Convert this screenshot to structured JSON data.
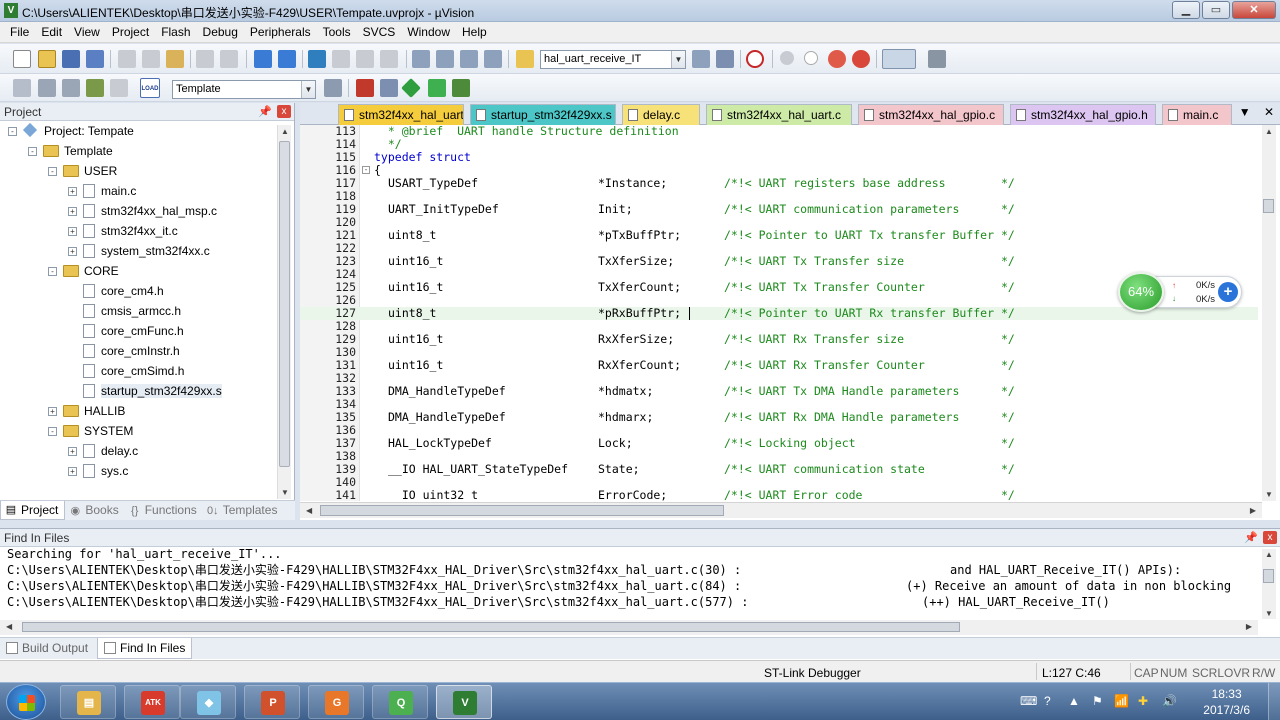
{
  "window": {
    "title": "C:\\Users\\ALIENTEK\\Desktop\\串口发送小实验-F429\\USER\\Tempate.uvprojx - µVision",
    "app_icon": "V",
    "controls": [
      "▁",
      "▭",
      "✕"
    ]
  },
  "menu": [
    "File",
    "Edit",
    "View",
    "Project",
    "Flash",
    "Debug",
    "Peripherals",
    "Tools",
    "SVCS",
    "Window",
    "Help"
  ],
  "toolbar": {
    "search_value": "hal_uart_receive_IT",
    "target_value": "Template",
    "load_label": "LOAD"
  },
  "project_panel": {
    "title": "Project",
    "pin": "📌",
    "close": "x",
    "tree": [
      {
        "label": "Project: Tempate",
        "kind": "project",
        "expander": "-"
      },
      {
        "label": "Template",
        "kind": "folder",
        "expander": "-"
      },
      {
        "label": "USER",
        "kind": "folder",
        "expander": "-"
      },
      {
        "label": "main.c",
        "kind": "file",
        "expander": "+"
      },
      {
        "label": "stm32f4xx_hal_msp.c",
        "kind": "file",
        "expander": "+"
      },
      {
        "label": "stm32f4xx_it.c",
        "kind": "file",
        "expander": "+"
      },
      {
        "label": "system_stm32f4xx.c",
        "kind": "file",
        "expander": "+"
      },
      {
        "label": "CORE",
        "kind": "folder",
        "expander": "-"
      },
      {
        "label": "core_cm4.h",
        "kind": "file",
        "expander": ""
      },
      {
        "label": "cmsis_armcc.h",
        "kind": "file",
        "expander": ""
      },
      {
        "label": "core_cmFunc.h",
        "kind": "file",
        "expander": ""
      },
      {
        "label": "core_cmInstr.h",
        "kind": "file",
        "expander": ""
      },
      {
        "label": "core_cmSimd.h",
        "kind": "file",
        "expander": ""
      },
      {
        "label": "startup_stm32f429xx.s",
        "kind": "file",
        "expander": ""
      },
      {
        "label": "HALLIB",
        "kind": "folder",
        "expander": "+"
      },
      {
        "label": "SYSTEM",
        "kind": "folder",
        "expander": "-"
      },
      {
        "label": "delay.c",
        "kind": "file",
        "expander": "+"
      },
      {
        "label": "sys.c",
        "kind": "file",
        "expander": "+"
      }
    ],
    "tabs": [
      {
        "label": "Project",
        "icon": "▤"
      },
      {
        "label": "Books",
        "icon": "◉"
      },
      {
        "label": "Functions",
        "icon": "{}"
      },
      {
        "label": "Templates",
        "icon": "0↓"
      }
    ]
  },
  "editor": {
    "tabs": [
      {
        "label": "stm32f4xx_hal_uart.h",
        "color": "#f5cd3c"
      },
      {
        "label": "startup_stm32f429xx.s",
        "color": "#4cc6c6"
      },
      {
        "label": "delay.c",
        "color": "#f7e27a"
      },
      {
        "label": "stm32f4xx_hal_uart.c",
        "color": "#cdeaa6"
      },
      {
        "label": "stm32f4xx_hal_gpio.c",
        "color": "#f3c6cc"
      },
      {
        "label": "stm32f4xx_hal_gpio.h",
        "color": "#dcc5f0"
      },
      {
        "label": "main.c",
        "color": "#f3c6cc"
      }
    ],
    "tab_controls": [
      "▼",
      "✕"
    ],
    "lines": [
      {
        "n": "113",
        "fold": "",
        "text": "  * @brief  UART handle Structure definition",
        "cls": "cm"
      },
      {
        "n": "114",
        "fold": "",
        "text": "  */",
        "cls": "cm"
      },
      {
        "n": "115",
        "fold": "",
        "kw": "typedef struct",
        "text": ""
      },
      {
        "n": "116",
        "fold": "-",
        "text": "{"
      },
      {
        "n": "117",
        "fold": "",
        "type": "USART_TypeDef",
        "field": "*Instance;",
        "comment": "/*!< UART registers base address        */"
      },
      {
        "n": "118",
        "fold": "",
        "text": ""
      },
      {
        "n": "119",
        "fold": "",
        "type": "UART_InitTypeDef",
        "field": "Init;",
        "comment": "/*!< UART communication parameters      */"
      },
      {
        "n": "120",
        "fold": "",
        "text": ""
      },
      {
        "n": "121",
        "fold": "",
        "type": "uint8_t",
        "field": "*pTxBuffPtr;",
        "comment": "/*!< Pointer to UART Tx transfer Buffer */"
      },
      {
        "n": "122",
        "fold": "",
        "text": ""
      },
      {
        "n": "123",
        "fold": "",
        "type": "uint16_t",
        "field": "TxXferSize;",
        "comment": "/*!< UART Tx Transfer size              */"
      },
      {
        "n": "124",
        "fold": "",
        "text": ""
      },
      {
        "n": "125",
        "fold": "",
        "type": "uint16_t",
        "field": "TxXferCount;",
        "comment": "/*!< UART Tx Transfer Counter           */"
      },
      {
        "n": "126",
        "fold": "",
        "text": ""
      },
      {
        "n": "127",
        "fold": "",
        "type": "uint8_t",
        "field": "*pRxBuffPtr;",
        "comment": "/*!< Pointer to UART Rx transfer Buffer */",
        "cursor": true
      },
      {
        "n": "128",
        "fold": "",
        "text": ""
      },
      {
        "n": "129",
        "fold": "",
        "type": "uint16_t",
        "field": "RxXferSize;",
        "comment": "/*!< UART Rx Transfer size              */"
      },
      {
        "n": "130",
        "fold": "",
        "text": ""
      },
      {
        "n": "131",
        "fold": "",
        "type": "uint16_t",
        "field": "RxXferCount;",
        "comment": "/*!< UART Rx Transfer Counter           */"
      },
      {
        "n": "132",
        "fold": "",
        "text": ""
      },
      {
        "n": "133",
        "fold": "",
        "type": "DMA_HandleTypeDef",
        "field": "*hdmatx;",
        "comment": "/*!< UART Tx DMA Handle parameters      */"
      },
      {
        "n": "134",
        "fold": "",
        "text": ""
      },
      {
        "n": "135",
        "fold": "",
        "type": "DMA_HandleTypeDef",
        "field": "*hdmarx;",
        "comment": "/*!< UART Rx DMA Handle parameters      */"
      },
      {
        "n": "136",
        "fold": "",
        "text": ""
      },
      {
        "n": "137",
        "fold": "",
        "type": "HAL_LockTypeDef",
        "field": "Lock;",
        "comment": "/*!< Locking object                     */"
      },
      {
        "n": "138",
        "fold": "",
        "text": ""
      },
      {
        "n": "139",
        "fold": "",
        "type": "__IO HAL_UART_StateTypeDef",
        "field": "State;",
        "comment": "/*!< UART communication state           */"
      },
      {
        "n": "140",
        "fold": "",
        "text": ""
      },
      {
        "n": "141",
        "fold": "",
        "type": "__IO uint32_t",
        "field": "ErrorCode;",
        "comment": "/*!< UART Error code                    */"
      }
    ]
  },
  "net_widget": {
    "percent": "64%",
    "up_rate": "0K/s",
    "down_rate": "0K/s",
    "up_arrow": "↑",
    "down_arrow": "↓",
    "plus": "+"
  },
  "find_panel": {
    "title": "Find In Files",
    "pin": "📌",
    "close": "x",
    "lines": [
      {
        "left": "Searching for 'hal_uart_receive_IT'...",
        "right": ""
      },
      {
        "left": "C:\\Users\\ALIENTEK\\Desktop\\串口发送小实验-F429\\HALLIB\\STM32F4xx_HAL_Driver\\Src\\stm32f4xx_hal_uart.c(30) :",
        "right": "and HAL_UART_Receive_IT() APIs):"
      },
      {
        "left": "C:\\Users\\ALIENTEK\\Desktop\\串口发送小实验-F429\\HALLIB\\STM32F4xx_HAL_Driver\\Src\\stm32f4xx_hal_uart.c(84) :",
        "right": "(+) Receive an amount of data in non blocking"
      },
      {
        "left": "C:\\Users\\ALIENTEK\\Desktop\\串口发送小实验-F429\\HALLIB\\STM32F4xx_HAL_Driver\\Src\\stm32f4xx_hal_uart.c(577) :",
        "right": "(++) HAL_UART_Receive_IT()"
      }
    ],
    "tabs": [
      "Build Output",
      "Find In Files"
    ]
  },
  "status": {
    "debugger": "ST-Link Debugger",
    "position": "L:127 C:46",
    "indicators": [
      "CAP",
      "NUM",
      "SCRL",
      "OVR",
      "R/W"
    ]
  },
  "taskbar": {
    "apps": [
      {
        "name": "explorer",
        "glyph": "▤",
        "color": "#e3b54a"
      },
      {
        "name": "atk",
        "glyph": "ATK",
        "color": "#d83b2b"
      },
      {
        "name": "notebook",
        "glyph": "◆",
        "color": "#7fc3e6"
      },
      {
        "name": "powerpoint",
        "glyph": "P",
        "color": "#d0512c"
      },
      {
        "name": "pdf",
        "glyph": "G",
        "color": "#e8772a"
      },
      {
        "name": "app-q",
        "glyph": "Q",
        "color": "#4caf50"
      },
      {
        "name": "keil",
        "glyph": "V",
        "color": "#2e7d32"
      }
    ],
    "time": "18:33",
    "date": "2017/3/6"
  }
}
